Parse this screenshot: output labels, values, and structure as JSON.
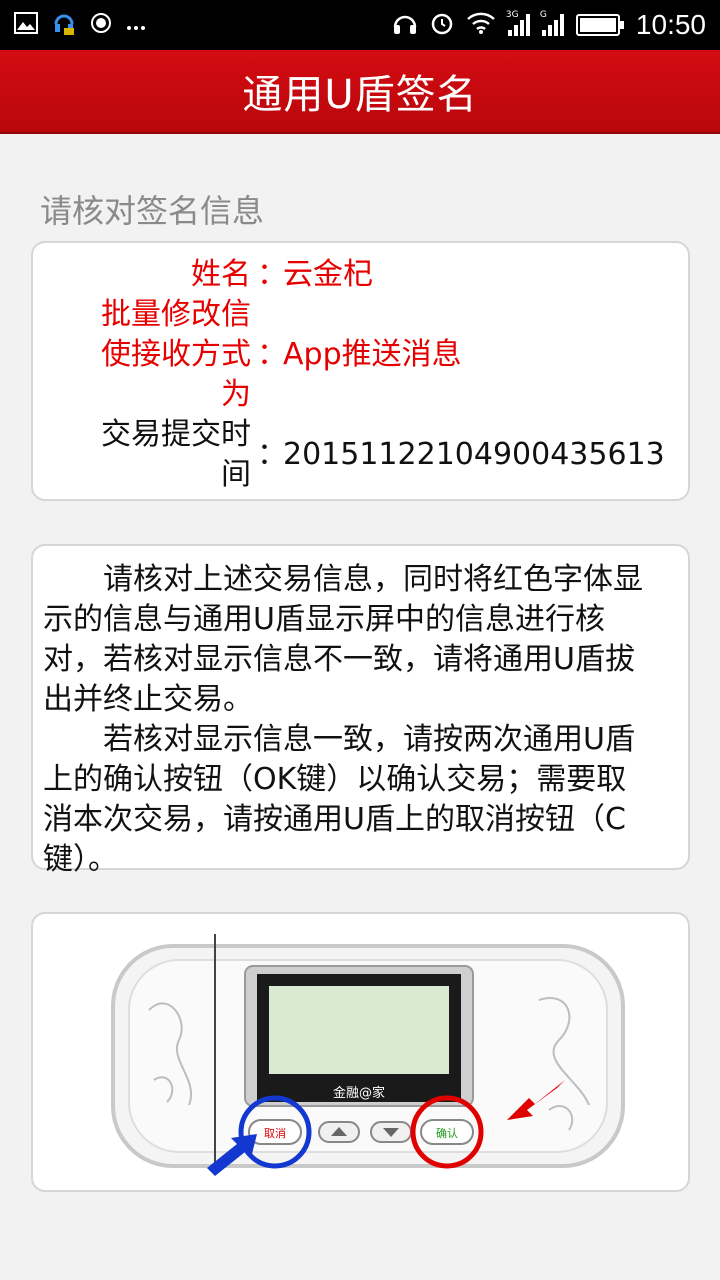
{
  "status_bar": {
    "time": "10:50",
    "left_icons": [
      "image-icon",
      "headset-app-icon",
      "record-icon",
      "more-icon"
    ],
    "right_icons": [
      "headphones-icon",
      "alarm-icon",
      "wifi-icon",
      "signal-3g-icon",
      "signal-g-icon",
      "battery-icon"
    ],
    "signal_tags": [
      "3G",
      "G"
    ]
  },
  "header": {
    "title": "通用U盾签名"
  },
  "section": {
    "title": "请核对签名信息"
  },
  "info": {
    "rows": [
      {
        "label": "姓名",
        "colon": "：",
        "value": "云金杞"
      },
      {
        "label_lines": [
          "批量修改信",
          "使接收方式",
          "为"
        ],
        "colon": "：",
        "value": "App推送消息"
      },
      {
        "label_lines": [
          "交易提交时",
          "间"
        ],
        "colon": "：",
        "value": "20151122104900435613"
      }
    ]
  },
  "notice": {
    "lines": [
      "请核对上述交易信息，同时将红色字体显",
      "示的信息与通用U盾显示屏中的信息进行核",
      "对，若核对显示信息不一致，请将通用U盾拔",
      "出并终止交易。",
      "若核对显示信息一致，请按两次通用U盾",
      "上的确认按钮（OK键）以确认交易；需要取",
      "消本次交易，请按通用U盾上的取消按钮（C",
      "键）。"
    ]
  },
  "device": {
    "brand": "金融@家",
    "cancel_label": "取消",
    "confirm_label": "确认"
  },
  "colors": {
    "header_red": "#c8090e",
    "highlight_red": "#e60000",
    "cancel_circle": "#1238d0",
    "confirm_circle": "#e00000"
  }
}
